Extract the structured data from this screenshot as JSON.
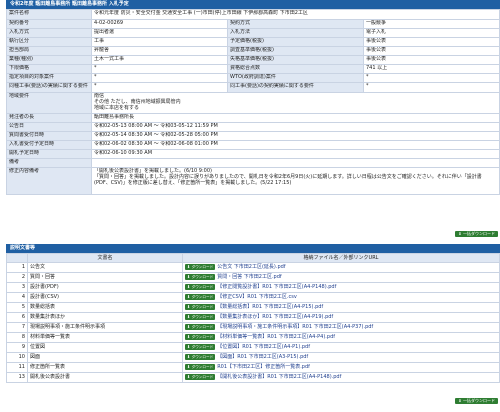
{
  "header": {
    "title": "令和2年度 甑田離島事務所 甑田離島事務所 入札予定"
  },
  "info_rows": [
    {
      "label": "案件名称",
      "value": "令和元年度 防災・安全交付金 交通安全工事 (一)市田(停)上市田線 下伊那郡高森町 下市田2工区",
      "h": "h9"
    },
    {
      "label": "契約番号",
      "value": "4-02-00269",
      "label2": "契約方式",
      "value2": "一般競争",
      "h": "h8"
    },
    {
      "label": "入札方式",
      "value": "提出者選",
      "label2": "入札方法",
      "value2": "電子入札",
      "h": "h8"
    },
    {
      "label": "執行区分",
      "value": "工事",
      "label2": "予定価格(税抜)",
      "value2": "事後公表",
      "h": "h8"
    },
    {
      "label": "担当部局",
      "value": "昇龍舎",
      "label2": "調査基準価格(税抜)",
      "value2": "事後公表",
      "h": "h8"
    },
    {
      "label": "業種(種別)",
      "value": "土木一式工事",
      "label2": "失格基準価格(税抜)",
      "value2": "事後公表",
      "h": "h8"
    },
    {
      "label": "下限価格",
      "value": "*",
      "label2": "資格総合点数",
      "value2": "741 以上",
      "h": "h8"
    },
    {
      "label": "指定項目的対象案件",
      "value": "*",
      "label2": "WTO(政府調達)案件",
      "value2": "*",
      "h": "h8"
    },
    {
      "label": "同種工事(要話)の実績に関する要件",
      "value": "*",
      "label2": "同工事(要話)の契約実績に関する要件",
      "value2": "*",
      "h": "h9"
    },
    {
      "label": "地域要件",
      "value": "南信\nその他 ただし、南信州地域振興局管内\n地域に本店を有する",
      "h": "h20"
    },
    {
      "label": "発注者の長",
      "value": "甑田離島事務所長",
      "h": "h8"
    },
    {
      "label": "公告日",
      "value": "令和02-05-13 08:00 AM ～ 令和03-05-12 11:59 PM",
      "h": "h8"
    },
    {
      "label": "質問書受付日時",
      "value": "令和02-05-14 08:30 AM ～ 令和02-05-28 05:00 PM",
      "h": "h8"
    },
    {
      "label": "入札書受付予定日時",
      "value": "令和02-06-02 08:30 AM ～ 令和02-06-08 01:00 PM",
      "h": "h8"
    },
    {
      "label": "開札予定日時",
      "value": "令和02-06-10 09:30 AM",
      "h": "h8"
    },
    {
      "label": "備考",
      "value": "",
      "h": "h8"
    },
    {
      "label": "修正内容備考",
      "value": "「開札後公表設計書」を掲載しました。(6/10 9:00)\n「質問・回答」を掲載しました。設計内容に誤りがありましたので、開札日を令和2年6月9日(火)に延期します。詳しい日程は公告文をご確認ください。それに伴い「設計書(PDF、CSV)」を修正版に差し替え、「修正箇所一覧表」を掲載しました。(5/22 17:15)",
      "h": "h26"
    }
  ],
  "top_download_label": "一括ダウンロード",
  "docs_header": {
    "title": "説明文書等"
  },
  "docs_columns": {
    "name": "文書名",
    "file": "格納ファイル名／外部リンクURL"
  },
  "download_btn_label": "ダウンロード",
  "docs": [
    {
      "no": "1",
      "name": "公告文",
      "file": "公告文 下市田2工区(延長).pdf"
    },
    {
      "no": "2",
      "name": "質問・回答",
      "file": "質問・回答 下市田2工区.pdf"
    },
    {
      "no": "3",
      "name": "設計書(PDF)",
      "file": "【修正閲覧設計書】R01 下市田2工区(A4-P148).pdf"
    },
    {
      "no": "4",
      "name": "設計書(CSV)",
      "file": "【修正CSV】R01 下市田2工区.csv"
    },
    {
      "no": "5",
      "name": "数量総括表",
      "file": "【数量総括表】R01 下市田2工区(A4-P15).pdf"
    },
    {
      "no": "6",
      "name": "数量集計表ほか",
      "file": "【数量集計表ほか】R01 下市田2工区(A4-P19).pdf"
    },
    {
      "no": "7",
      "name": "現場説明事項・施工条件明示事項",
      "file": "【現場説明事項・施工条件明示事項】R01 下市田2工区(A4-P37).pdf"
    },
    {
      "no": "8",
      "name": "材料単価等一覧表",
      "file": "【材料単価等一覧表】R01 下市田2工区(A4-P4).pdf"
    },
    {
      "no": "9",
      "name": "位置図",
      "file": "【位置図】R01 下市田2工区(A4-P1).pdf"
    },
    {
      "no": "10",
      "name": "図面",
      "file": "【図面】R01 下市田2工区(A3-P15).pdf"
    },
    {
      "no": "11",
      "name": "修正箇所一覧表",
      "file": "R01【下市田2工区】修正箇所一覧表.pdf"
    },
    {
      "no": "13",
      "name": "開札後公表設計書",
      "file": "【開札後公表設計書】R01 下市田2工区(A4-P148).pdf"
    }
  ],
  "bottom_download_label": "一括ダウンロード"
}
